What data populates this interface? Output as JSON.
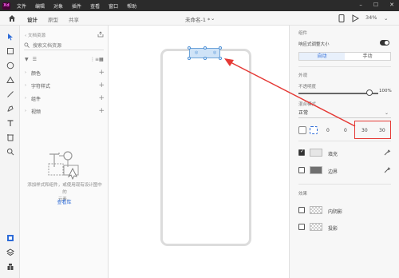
{
  "menubar": {
    "app_logo": "Xd",
    "items": [
      "文件",
      "编辑",
      "对象",
      "插件",
      "查看",
      "窗口",
      "帮助"
    ],
    "window_controls": [
      "minimize-icon",
      "maximize-icon",
      "close-icon"
    ]
  },
  "toolbar": {
    "tabs": [
      "设计",
      "原型",
      "共享"
    ],
    "active_tab": "设计",
    "document_title": "未命名-1 *",
    "zoom": "34%"
  },
  "assets_panel": {
    "header": "文档资源",
    "search_placeholder": "搜索文档资源",
    "sections": [
      {
        "label": "颜色"
      },
      {
        "label": "字符样式"
      },
      {
        "label": "组件"
      },
      {
        "label": "视频"
      }
    ],
    "empty_text_line1": "添加样式和组件，或使用现有设计图中的",
    "empty_text_line2": "元素。",
    "learn_link": "查看库"
  },
  "properties": {
    "section_top_label": "组件",
    "responsive_resize": "响应式调整大小",
    "resize_modes": [
      "自动",
      "手动"
    ],
    "active_resize_mode": "自动",
    "appearance_label": "外观",
    "opacity_label": "不透明度",
    "opacity_value": "100%",
    "blend_label": "混合模式",
    "blend_value": "正常",
    "radius": {
      "values": [
        "0",
        "0",
        "30",
        "30"
      ]
    },
    "fill": {
      "label": "填充",
      "checked": true,
      "color": "#e6e6e6"
    },
    "border": {
      "label": "边界",
      "checked": false,
      "color": "#707070"
    },
    "effects_label": "效果",
    "inner_shadow": {
      "label": "内阴影",
      "checked": false
    },
    "drop_shadow": {
      "label": "投影",
      "checked": false
    }
  },
  "colors": {
    "annotation_red": "#e53935",
    "accent_blue": "#2d6bd8"
  }
}
